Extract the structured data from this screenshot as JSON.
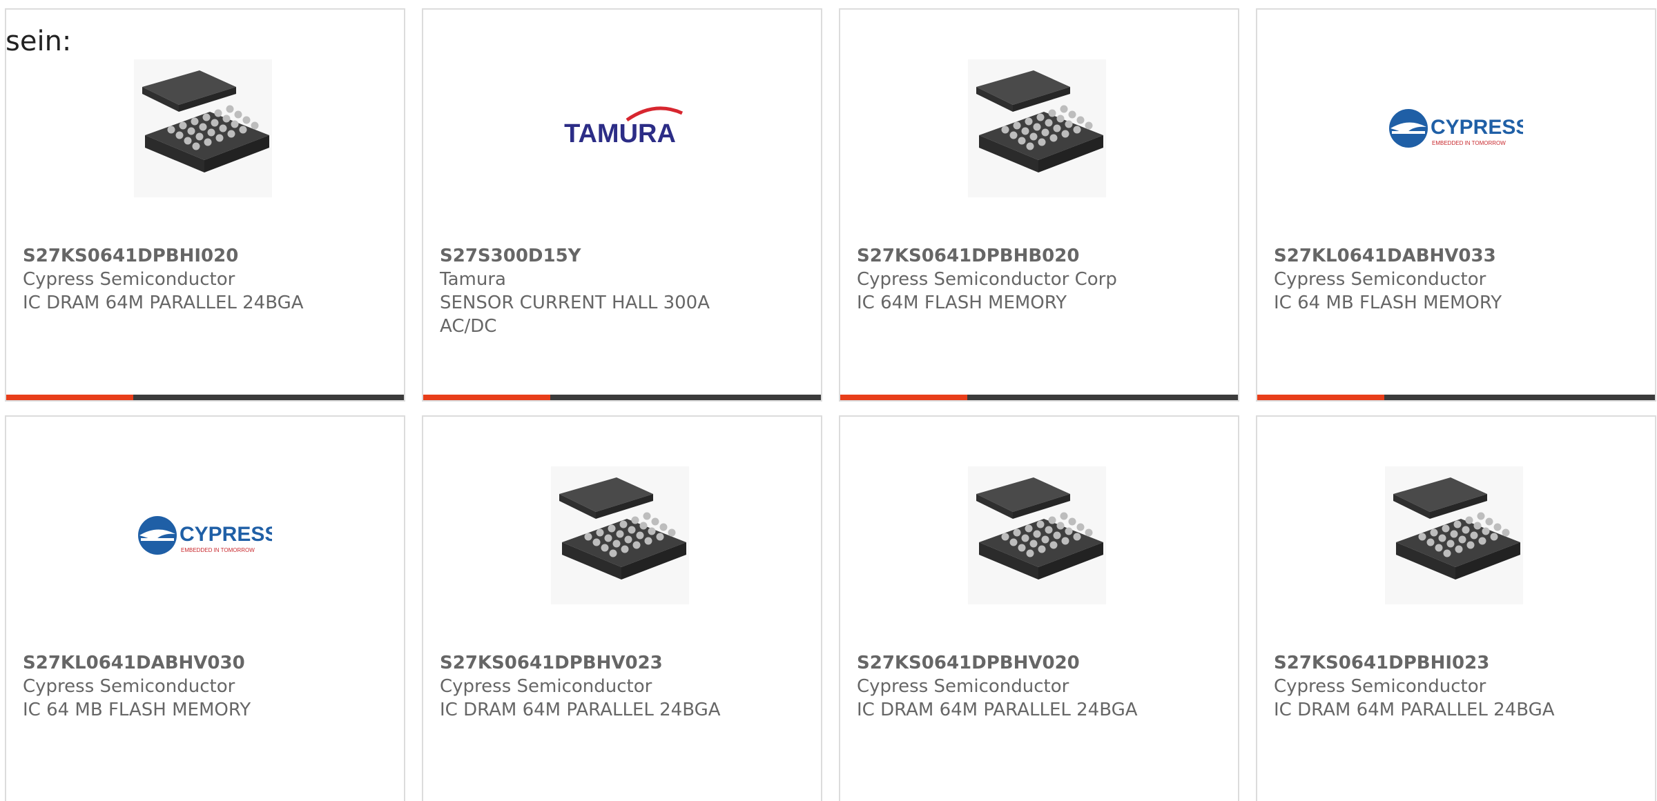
{
  "intro_text": "sein:",
  "colors": {
    "accent": "#e83e1a",
    "bar_track": "#3b3b3b",
    "text": "#666666",
    "border": "#dcdcdc",
    "tamura_blue": "#2c2d86",
    "tamura_red": "#d7262f",
    "cypress_blue": "#1f5fa6",
    "cypress_red": "#c8282d"
  },
  "products": [
    {
      "part": "S27KS0641DPBHI020",
      "manufacturer": "Cypress Semiconductor",
      "description": "IC DRAM 64M PARALLEL 24BGA",
      "image": "bga-chip-icon",
      "progress": 0.32
    },
    {
      "part": "S27S300D15Y",
      "manufacturer": "Tamura",
      "description": "SENSOR CURRENT HALL 300A AC/DC",
      "image": "tamura-logo",
      "progress": 0.32
    },
    {
      "part": "S27KS0641DPBHB020",
      "manufacturer": "Cypress Semiconductor Corp",
      "description": "IC 64M FLASH MEMORY",
      "image": "bga-chip-icon",
      "progress": 0.32
    },
    {
      "part": "S27KL0641DABHV033",
      "manufacturer": "Cypress Semiconductor",
      "description": "IC 64 MB FLASH MEMORY",
      "image": "cypress-logo",
      "progress": 0.32
    },
    {
      "part": "S27KL0641DABHV030",
      "manufacturer": "Cypress Semiconductor",
      "description": "IC 64 MB FLASH MEMORY",
      "image": "cypress-logo"
    },
    {
      "part": "S27KS0641DPBHV023",
      "manufacturer": "Cypress Semiconductor",
      "description": "IC DRAM 64M PARALLEL 24BGA",
      "image": "bga-chip-icon"
    },
    {
      "part": "S27KS0641DPBHV020",
      "manufacturer": "Cypress Semiconductor",
      "description": "IC DRAM 64M PARALLEL 24BGA",
      "image": "bga-chip-icon"
    },
    {
      "part": "S27KS0641DPBHI023",
      "manufacturer": "Cypress Semiconductor",
      "description": "IC DRAM 64M PARALLEL 24BGA",
      "image": "bga-chip-icon"
    }
  ],
  "logos": {
    "tamura": "TAMURA",
    "cypress": "CYPRESS",
    "cypress_tagline": "EMBEDDED IN TOMORROW"
  }
}
